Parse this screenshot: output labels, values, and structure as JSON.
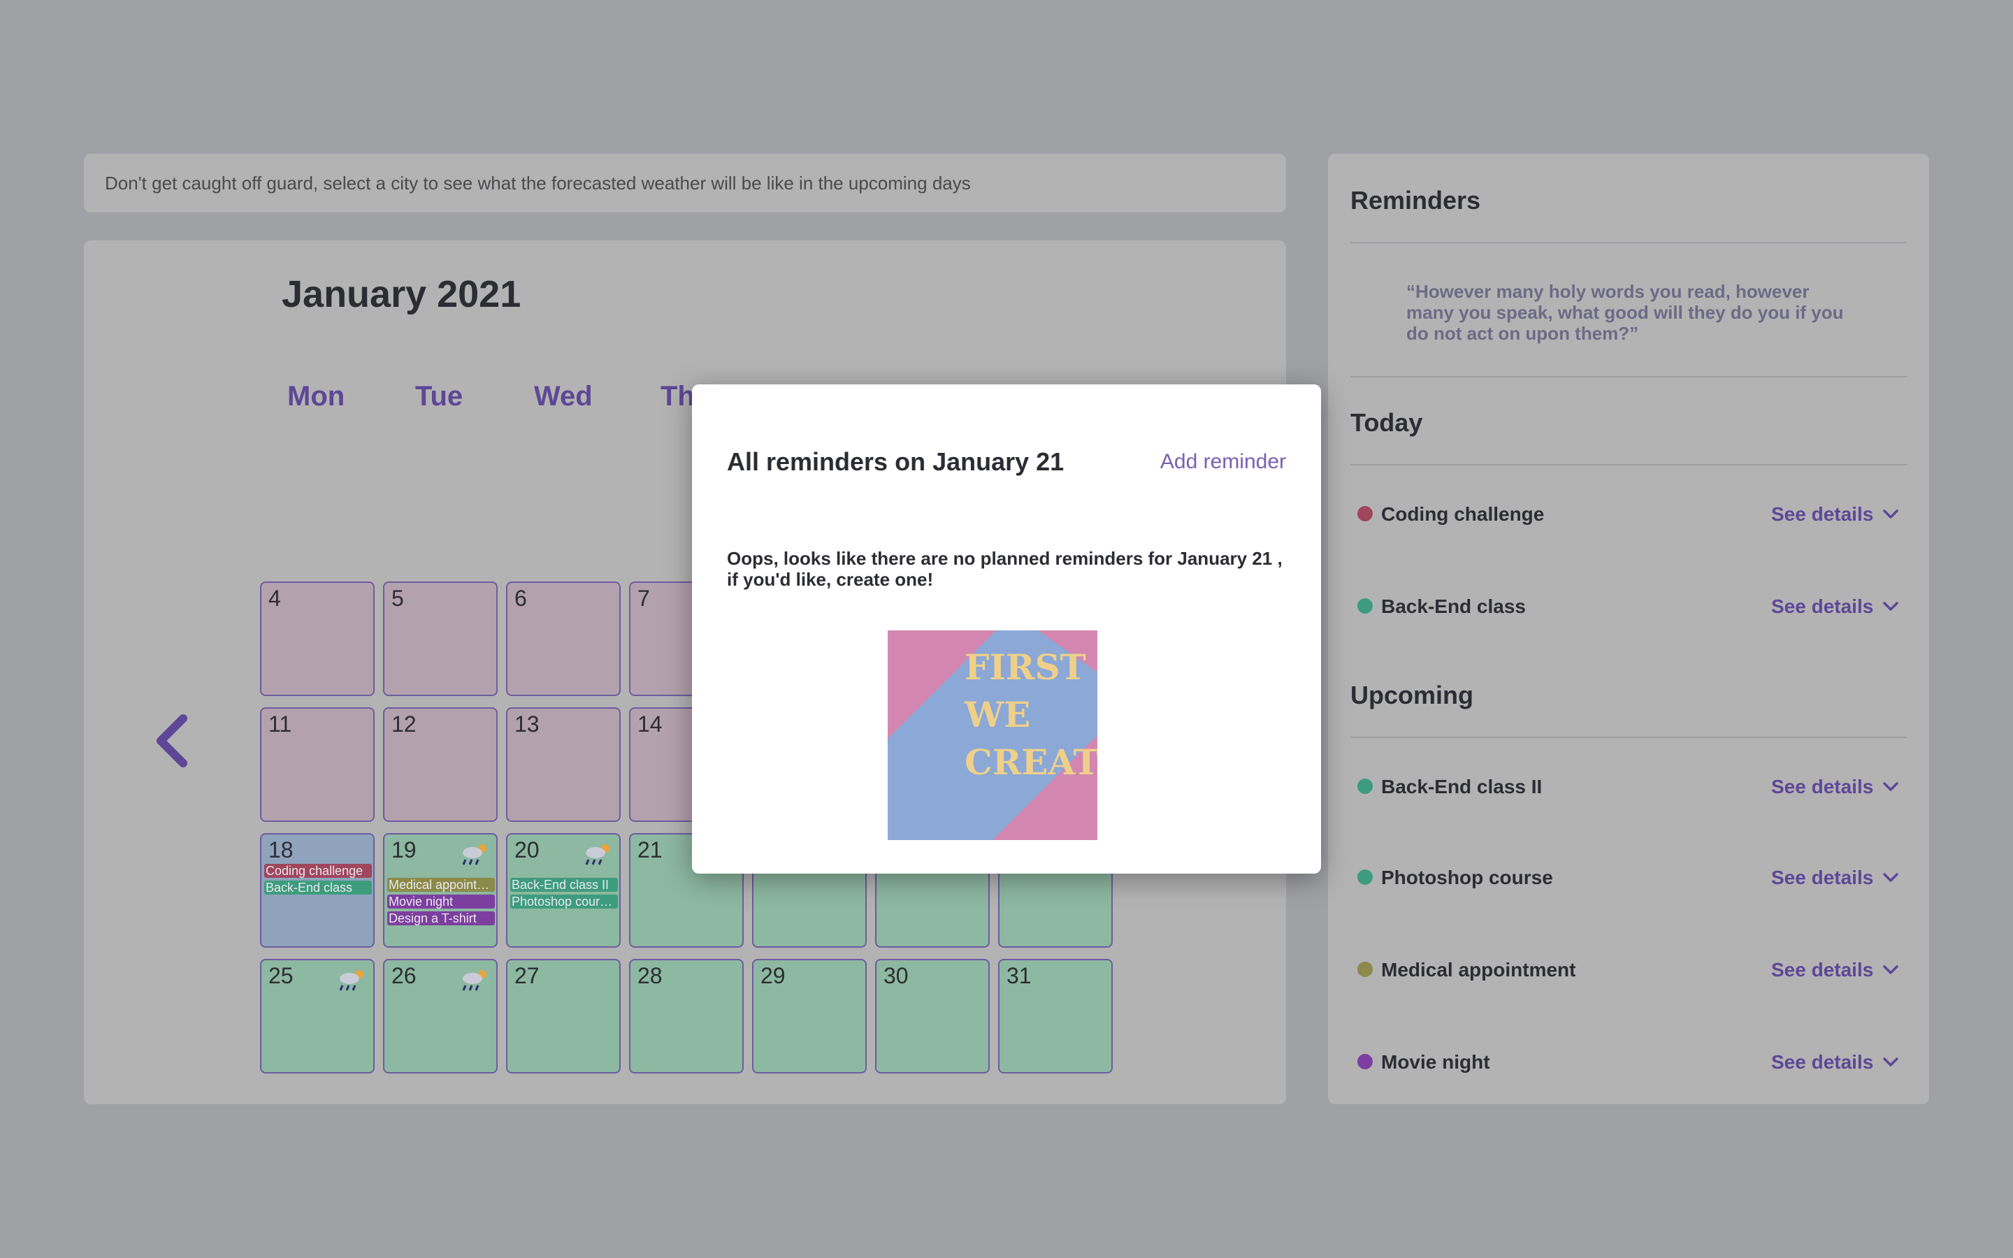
{
  "banner": {
    "text": "Don't get caught off guard, select a city to see what the forecasted weather will be like in the upcoming days"
  },
  "calendar": {
    "month_title": "January 2021",
    "weekdays": [
      "Mon",
      "Tue",
      "Wed",
      "Th"
    ],
    "days": {
      "d4": "4",
      "d5": "5",
      "d6": "6",
      "d7": "7",
      "d11": "11",
      "d12": "12",
      "d13": "13",
      "d14": "14",
      "d18": "18",
      "d19": "19",
      "d20": "20",
      "d21": "21",
      "d25": "25",
      "d26": "26",
      "d27": "27",
      "d28": "28",
      "d29": "29",
      "d30": "30",
      "d31": "31"
    },
    "chips": {
      "d18": [
        "Coding challenge",
        "Back-End class"
      ],
      "d19": [
        "Medical appoint…",
        "Movie night",
        "Design a T-shirt"
      ],
      "d20": [
        "Back-End class II",
        "Photoshop cour…"
      ]
    },
    "colors": {
      "past": "#b3a1ad",
      "today": "#8fa3bd",
      "future": "#8db8a1",
      "accent": "#5e4796"
    }
  },
  "sidebar": {
    "title": "Reminders",
    "quote": "“However many holy words you read, however many you speak, what good will they do you if you do not act on upon them?”",
    "today_heading": "Today",
    "upcoming_heading": "Upcoming",
    "see_details": "See details",
    "today": [
      {
        "title": "Coding challenge",
        "color": "#a0465e"
      },
      {
        "title": "Back-End class",
        "color": "#3e9c7e"
      }
    ],
    "upcoming": [
      {
        "title": "Back-End class II",
        "color": "#3e9c7e"
      },
      {
        "title": "Photoshop course",
        "color": "#3e9c7e"
      },
      {
        "title": "Medical appointment",
        "color": "#8c8a4a"
      },
      {
        "title": "Movie night",
        "color": "#7d3f9f"
      }
    ]
  },
  "modal": {
    "title": "All reminders on January 21",
    "add_label": "Add reminder",
    "message": "Oops, looks like there are no planned reminders for January 21 , if you'd like, create one!",
    "image_text": [
      "FIRST",
      "WE",
      "CREATE"
    ]
  }
}
